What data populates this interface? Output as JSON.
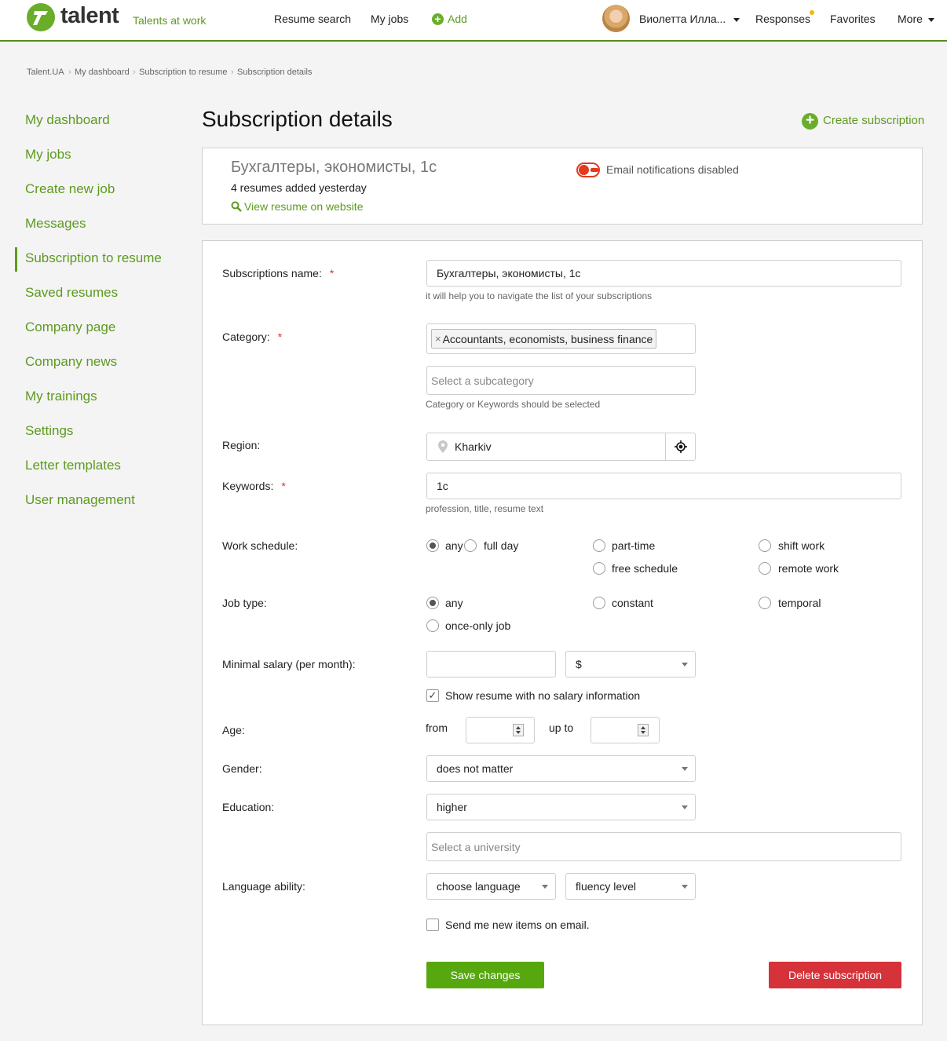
{
  "header": {
    "logo": "talent",
    "tagline": "Talents at work",
    "nav": {
      "resume_search": "Resume search",
      "my_jobs": "My jobs",
      "add": "Add"
    },
    "user_name": "Виолетта Илла...",
    "responses": "Responses",
    "favorites": "Favorites",
    "more": "More"
  },
  "breadcrumb": [
    "Talent.UA",
    "My dashboard",
    "Subscription to resume",
    "Subscription details"
  ],
  "sidebar": {
    "items": [
      {
        "label": "My dashboard"
      },
      {
        "label": "My jobs"
      },
      {
        "label": "Create new job"
      },
      {
        "label": "Messages"
      },
      {
        "label": "Subscription to resume",
        "active": true
      },
      {
        "label": "Saved resumes"
      },
      {
        "label": "Company page"
      },
      {
        "label": "Company news"
      },
      {
        "label": "My trainings"
      },
      {
        "label": "Settings"
      },
      {
        "label": "Letter templates"
      },
      {
        "label": "User management"
      }
    ]
  },
  "page": {
    "title": "Subscription details",
    "create_link": "Create subscription"
  },
  "summary": {
    "title": "Бухгалтеры, экономисты, 1с",
    "added": "4 resumes added yesterday",
    "view_link": "View resume on website",
    "notifications": "Email notifications disabled"
  },
  "form": {
    "name": {
      "label": "Subscriptions name:",
      "required": "*",
      "value": "Бухгалтеры, экономисты, 1с",
      "hint": "it will help you to navigate the list of your subscriptions"
    },
    "category": {
      "label": "Category:",
      "required": "*",
      "tag_remove": "×",
      "tag": "Accountants, economists, business finance",
      "subcategory_placeholder": "Select a subcategory",
      "hint": "Category or Keywords should be selected"
    },
    "region": {
      "label": "Region:",
      "value": "Kharkiv"
    },
    "keywords": {
      "label": "Keywords:",
      "required": "*",
      "value": "1c",
      "hint": "profession, title, resume text"
    },
    "work_schedule": {
      "label": "Work schedule:",
      "options": [
        "any",
        "full day",
        "part-time",
        "shift work",
        "free schedule",
        "remote work"
      ],
      "selected": "any"
    },
    "job_type": {
      "label": "Job type:",
      "options": [
        "any",
        "constant",
        "temporal",
        "once-only job"
      ],
      "selected": "any"
    },
    "salary": {
      "label": "Minimal salary (per month):",
      "value": "",
      "currency": "$",
      "no_salary_label": "Show resume with no salary information",
      "no_salary_checked": true
    },
    "age": {
      "label": "Age:",
      "from": "from",
      "up_to": "up to"
    },
    "gender": {
      "label": "Gender:",
      "value": "does not matter"
    },
    "education": {
      "label": "Education:",
      "value": "higher",
      "university_placeholder": "Select a university"
    },
    "language": {
      "label": "Language ability:",
      "language": "choose language",
      "fluency": "fluency level"
    },
    "email": {
      "label": "Send me new items on email.",
      "checked": false
    },
    "save": "Save changes",
    "delete": "Delete subscription"
  },
  "colors": {
    "brand_green": "#6aad2a",
    "link_green": "#5d9a1f",
    "save_button": "#57a80f",
    "delete_button": "#d6323a",
    "toggle_off": "#e23b1f"
  }
}
